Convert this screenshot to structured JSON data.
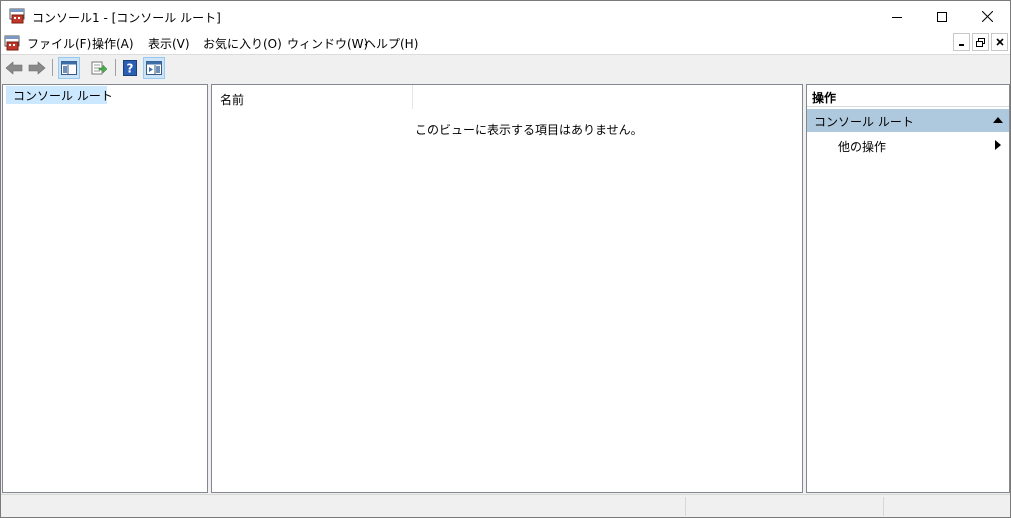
{
  "window": {
    "title": "コンソール1 - [コンソール ルート]"
  },
  "menu": {
    "items": [
      {
        "label": "ファイル(F)"
      },
      {
        "label": "操作(A)"
      },
      {
        "label": "表示(V)"
      },
      {
        "label": "お気に入り(O)"
      },
      {
        "label": "ウィンドウ(W)"
      },
      {
        "label": "ヘルプ(H)"
      }
    ]
  },
  "toolbar": {
    "buttons": [
      {
        "icon": "back-arrow-icon"
      },
      {
        "icon": "forward-arrow-icon"
      },
      {
        "icon": "show-hide-console-tree-icon",
        "pressed": true
      },
      {
        "icon": "export-list-icon"
      },
      {
        "icon": "help-icon"
      },
      {
        "icon": "show-hide-action-pane-icon",
        "pressed": true
      }
    ]
  },
  "tree": {
    "root_label": "コンソール ルート"
  },
  "main": {
    "column_header": "名前",
    "empty_message": "このビューに表示する項目はありません。"
  },
  "actions": {
    "header": "操作",
    "section_label": "コンソール ルート",
    "items": [
      {
        "label": "他の操作"
      }
    ]
  },
  "colors": {
    "accent_selection": "#cce8ff",
    "action_section": "#aec8de"
  }
}
